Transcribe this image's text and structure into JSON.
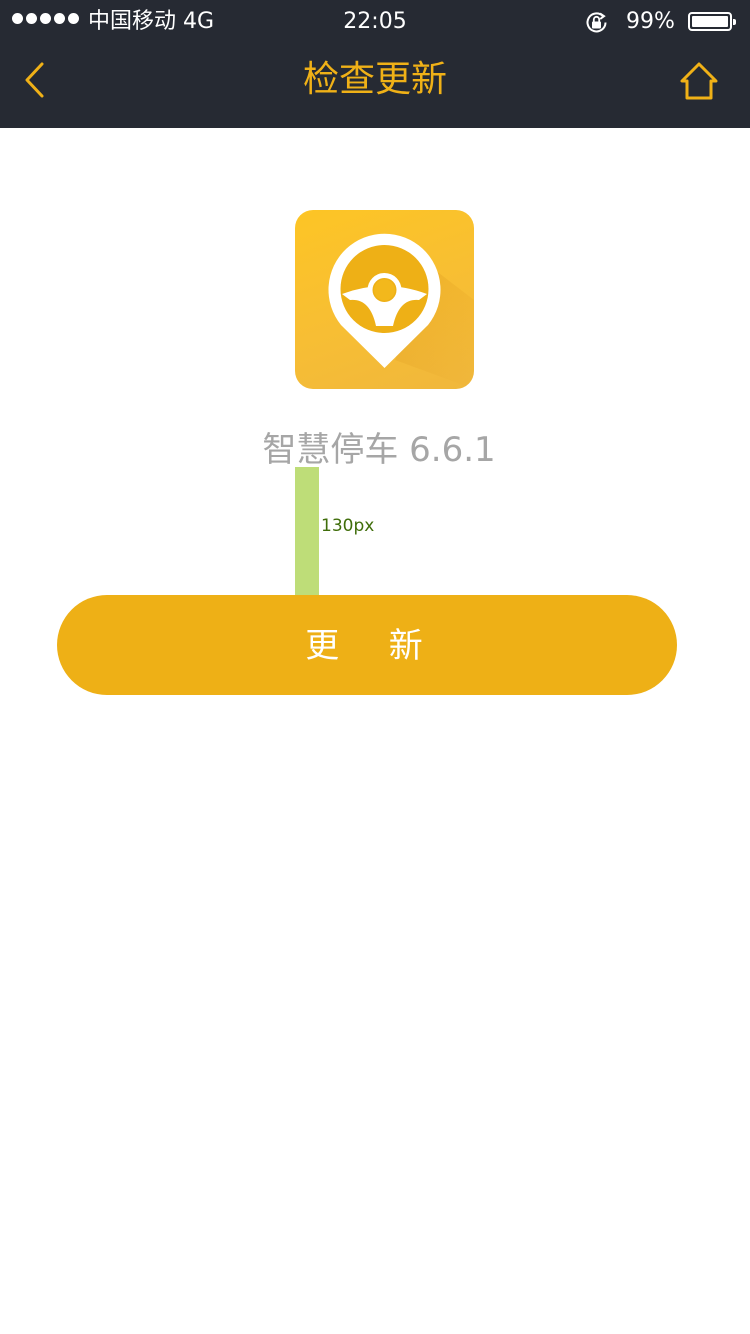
{
  "status_bar": {
    "carrier": "中国移动  4G",
    "time": "22:05",
    "battery_percent": "99%",
    "signal_dots": 5,
    "icons": [
      "signal-dots-icon",
      "rotation-lock-icon",
      "battery-icon"
    ]
  },
  "nav": {
    "title": "检查更新",
    "back_icon": "chevron-left-icon",
    "home_icon": "home-icon"
  },
  "app": {
    "icon": "steering-wheel-pin-icon",
    "name_version": "智慧停车 6.6.1"
  },
  "annotation": {
    "label": "130px"
  },
  "actions": {
    "update_label": "更 新"
  },
  "colors": {
    "topbar": "#262a33",
    "accent": "#f0b117",
    "button": "#eeb016",
    "muted_text": "#a6a6a6",
    "measure": "#bedd78"
  }
}
